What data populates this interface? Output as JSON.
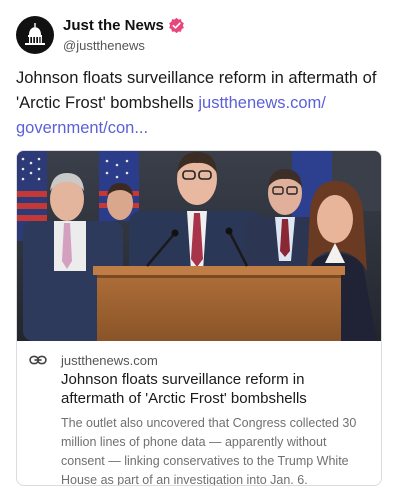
{
  "account": {
    "display_name": "Just the News",
    "handle": "@justthenews",
    "avatar_icon": "capitol-dome-icon",
    "verified_icon": "verified-badge-icon",
    "verified_color": "#e8467a"
  },
  "post": {
    "text": "Johnson floats surveillance reform in aftermath of 'Arctic Frost' bombshells ",
    "link_text": "justthenews.com/\ngovernment/con...",
    "link_color": "#5b61d6"
  },
  "card": {
    "link_icon": "link-icon",
    "domain": "justthenews.com",
    "title": "Johnson floats surveillance reform in aftermath of 'Arctic Frost' bombshells",
    "description": "The outlet also uncovered that Congress collected 30 million lines of phone data — apparently without consent — linking conservatives to the Trump White House as part of an investigation into Jan. 6.",
    "image_description": "press-conference-photo"
  }
}
